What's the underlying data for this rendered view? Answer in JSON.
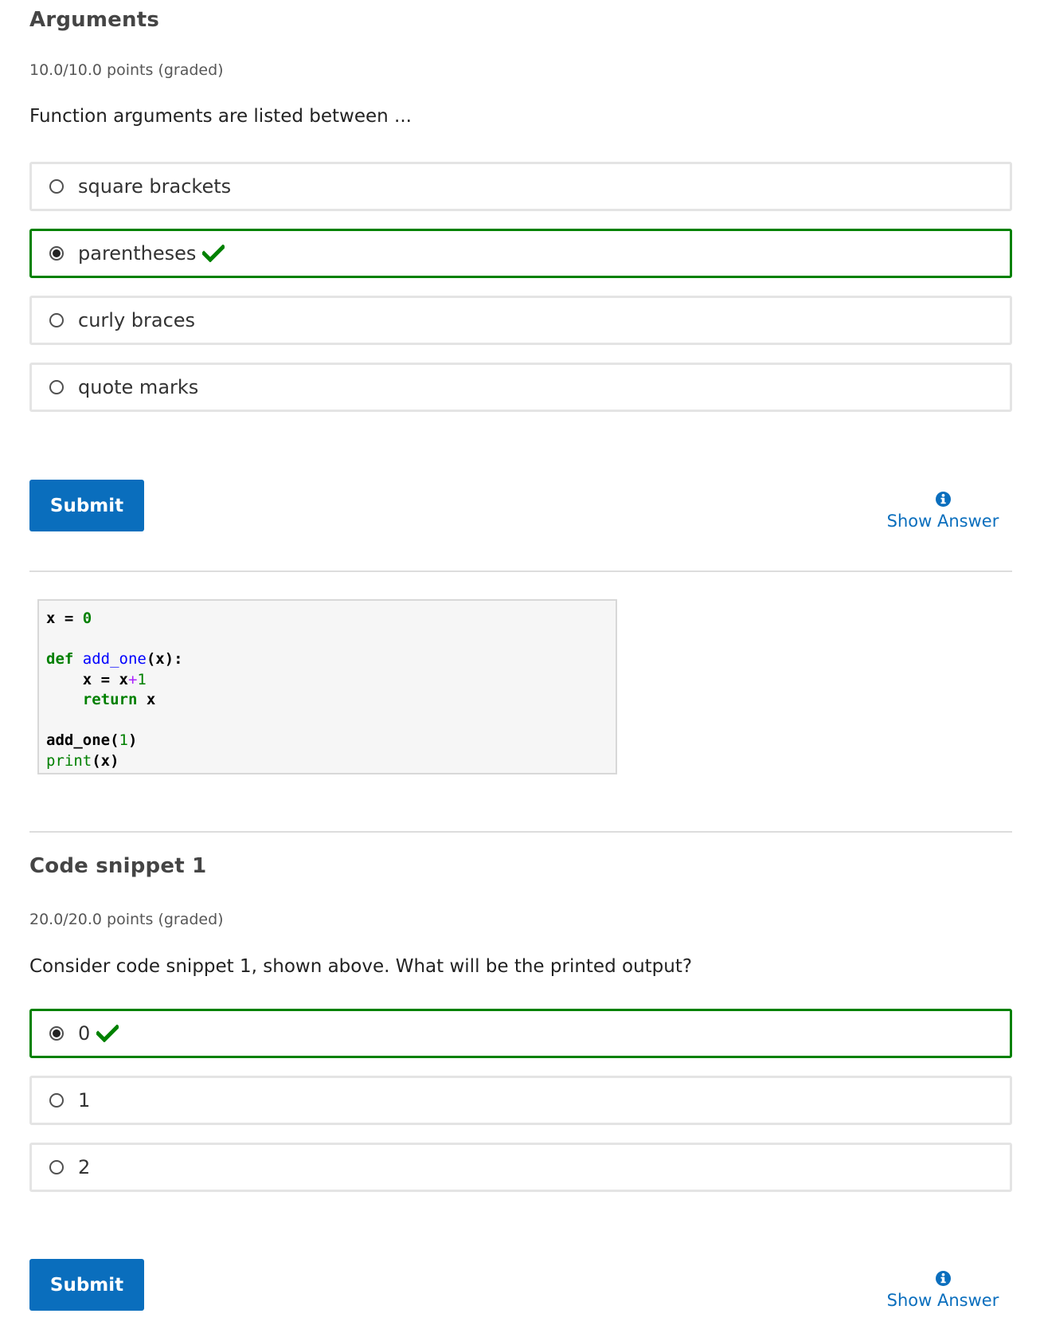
{
  "problem1": {
    "title": "Arguments",
    "points": "10.0/10.0 points (graded)",
    "question": "Function arguments are listed between ...",
    "options": [
      {
        "label": "square brackets",
        "checked": false,
        "correct": false
      },
      {
        "label": "parentheses",
        "checked": true,
        "correct": true
      },
      {
        "label": "curly braces",
        "checked": false,
        "correct": false
      },
      {
        "label": "quote marks",
        "checked": false,
        "correct": false
      }
    ],
    "submit_label": "Submit",
    "show_answer_label": "Show Answer"
  },
  "code_snippet": {
    "lines": [
      "x = 0",
      "",
      "def add_one(x):",
      "    x = x+1",
      "    return x",
      "",
      "add_one(1)",
      "print(x)"
    ]
  },
  "problem2": {
    "title": "Code snippet 1",
    "points": "20.0/20.0 points (graded)",
    "question": "Consider code snippet 1, shown above. What will be the printed output?",
    "options": [
      {
        "label": "0",
        "checked": true,
        "correct": true
      },
      {
        "label": "1",
        "checked": false,
        "correct": false
      },
      {
        "label": "2",
        "checked": false,
        "correct": false
      }
    ],
    "submit_label": "Submit",
    "show_answer_label": "Show Answer"
  },
  "colors": {
    "accent": "#0a6ebd",
    "correct": "#008100"
  },
  "icons": {
    "correct": "checkmark-icon",
    "info": "info-icon"
  }
}
